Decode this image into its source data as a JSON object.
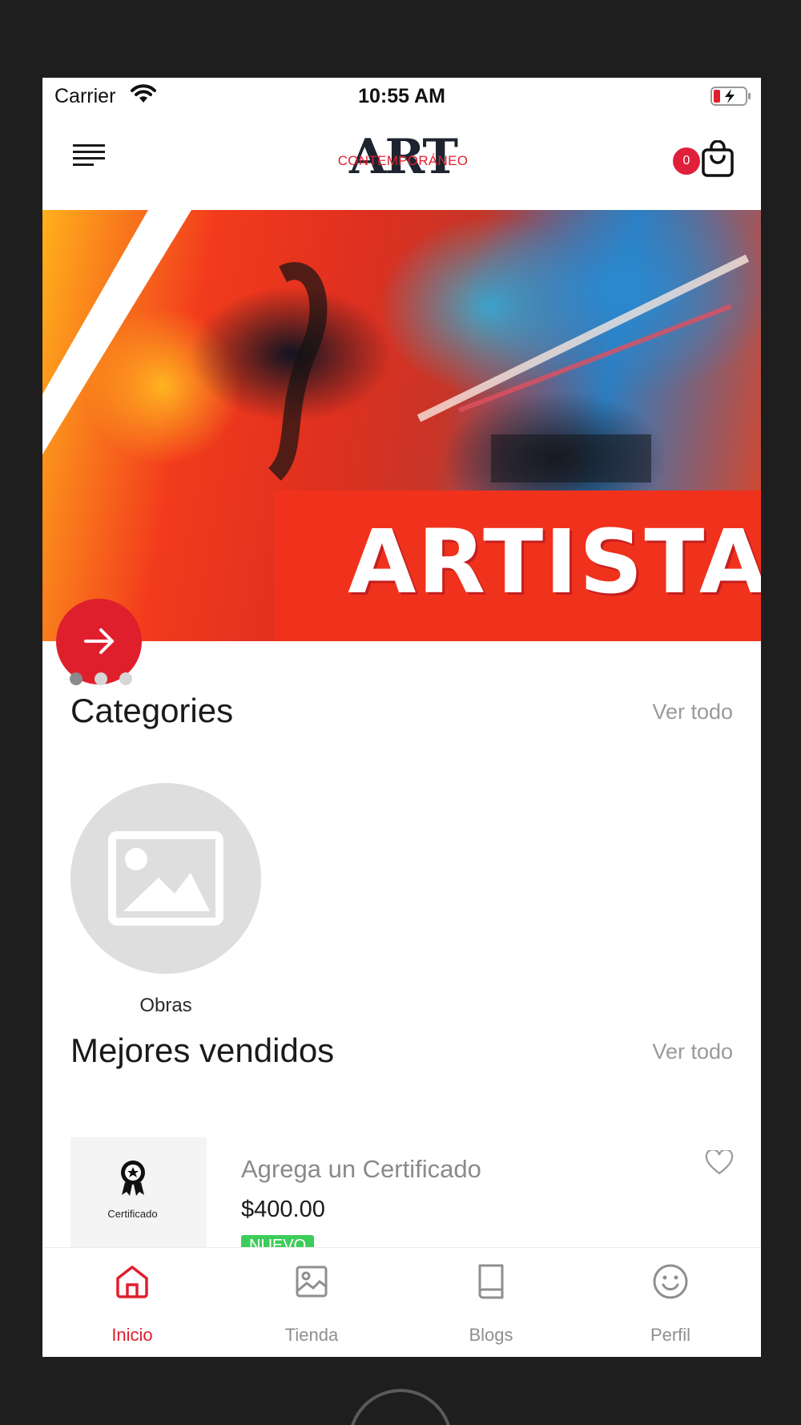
{
  "status_bar": {
    "carrier": "Carrier",
    "time": "10:55 AM",
    "wifi_icon": "wifi-icon",
    "battery_icon": "battery-charging-icon"
  },
  "header": {
    "menu_icon": "hamburger-menu-icon",
    "logo_main": "ART",
    "logo_sub": "CONTEMPORÁNEO",
    "cart_count": "0",
    "cart_icon": "shopping-bag-icon"
  },
  "hero": {
    "banner_text": "ARTISTA",
    "arrow_icon": "arrow-right-icon",
    "active_slide": 1,
    "slide_count": 3
  },
  "categories": {
    "title": "Categories",
    "see_all": "Ver todo",
    "items": [
      {
        "label": "Obras",
        "icon": "image-placeholder-icon"
      }
    ]
  },
  "best_sellers": {
    "title": "Mejores vendidos",
    "see_all": "Ver todo",
    "products": [
      {
        "name": "Agrega un Certificado",
        "price": "$400.00",
        "badge": "NUEVO",
        "thumb_caption": "Certificado",
        "thumb_icon": "award-ribbon-icon",
        "favorite_icon": "heart-outline-icon"
      }
    ]
  },
  "tab_bar": {
    "tabs": [
      {
        "label": "Inicio",
        "icon": "home-icon",
        "active": true
      },
      {
        "label": "Tienda",
        "icon": "image-icon",
        "active": false
      },
      {
        "label": "Blogs",
        "icon": "book-icon",
        "active": false
      },
      {
        "label": "Perfil",
        "icon": "smiley-icon",
        "active": false
      }
    ]
  },
  "colors": {
    "accent": "#e01f2d",
    "badge_green": "#3dcc5a",
    "text_dark": "#1a1a1a",
    "text_muted": "#9a9a9a"
  }
}
